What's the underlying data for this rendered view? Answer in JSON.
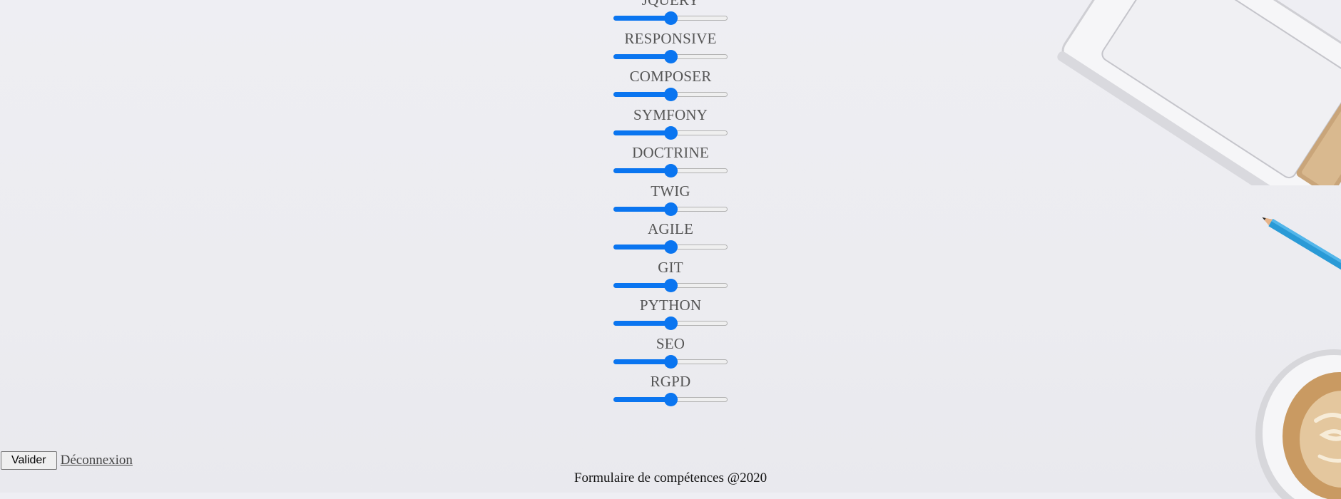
{
  "skills": [
    {
      "label": "JQUERY",
      "value": 50
    },
    {
      "label": "RESPONSIVE",
      "value": 50
    },
    {
      "label": "COMPOSER",
      "value": 50
    },
    {
      "label": "SYMFONY",
      "value": 50
    },
    {
      "label": "DOCTRINE",
      "value": 50
    },
    {
      "label": "TWIG",
      "value": 50
    },
    {
      "label": "AGILE",
      "value": 50
    },
    {
      "label": "GIT",
      "value": 50
    },
    {
      "label": "PYTHON",
      "value": 50
    },
    {
      "label": "SEO",
      "value": 50
    },
    {
      "label": "RGPD",
      "value": 50
    }
  ],
  "slider": {
    "min": 0,
    "max": 100,
    "accent_color": "#0a75f0"
  },
  "actions": {
    "submit_label": "Valider",
    "logout_label": "Déconnexion"
  },
  "footer": {
    "text": "Formulaire de compétences @2020"
  }
}
